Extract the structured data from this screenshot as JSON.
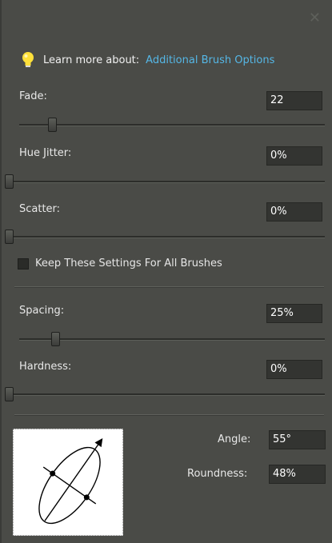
{
  "close_glyph": "✕",
  "learn": {
    "label": "Learn more about:",
    "link": "Additional Brush Options"
  },
  "fade": {
    "label": "Fade:",
    "value": "22",
    "slider_fraction": 0.11
  },
  "hue_jitter": {
    "label": "Hue Jitter:",
    "value": "0%",
    "slider_fraction": 0.0
  },
  "scatter": {
    "label": "Scatter:",
    "value": "0%",
    "slider_fraction": 0.0
  },
  "keep_settings": {
    "label": "Keep These Settings For All Brushes",
    "checked": false
  },
  "spacing": {
    "label": "Spacing:",
    "value": "25%",
    "slider_fraction": 0.12
  },
  "hardness": {
    "label": "Hardness:",
    "value": "0%",
    "slider_fraction": 0.0
  },
  "angle": {
    "label": "Angle:",
    "value": "55°"
  },
  "roundness": {
    "label": "Roundness:",
    "value": "48%"
  },
  "icons": {
    "bulb": "lightbulb-icon",
    "close": "close-icon"
  },
  "colors": {
    "accent_link": "#55b7e6",
    "panel_bg": "#4a4b47"
  }
}
